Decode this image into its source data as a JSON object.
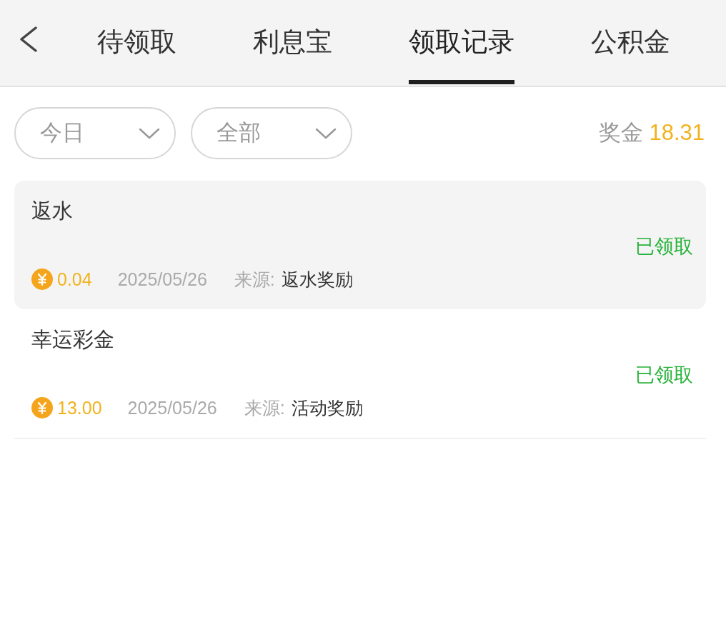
{
  "tabs": [
    {
      "label": "待领取",
      "selected": false
    },
    {
      "label": "利息宝",
      "selected": false
    },
    {
      "label": "领取记录",
      "selected": true
    },
    {
      "label": "公积金",
      "selected": false
    }
  ],
  "filters": [
    {
      "value": "今日"
    },
    {
      "value": "全部"
    }
  ],
  "bonus": {
    "label": "奖金",
    "amount": "18.31"
  },
  "records": [
    {
      "title": "返水",
      "status": "已领取",
      "amount": "0.04",
      "date": "2025/05/26",
      "source_label": "来源:",
      "source": "返水奖励",
      "selected": true
    },
    {
      "title": "幸运彩金",
      "status": "已领取",
      "amount": "13.00",
      "date": "2025/05/26",
      "source_label": "来源:",
      "source": "活动奖励",
      "selected": false
    }
  ]
}
